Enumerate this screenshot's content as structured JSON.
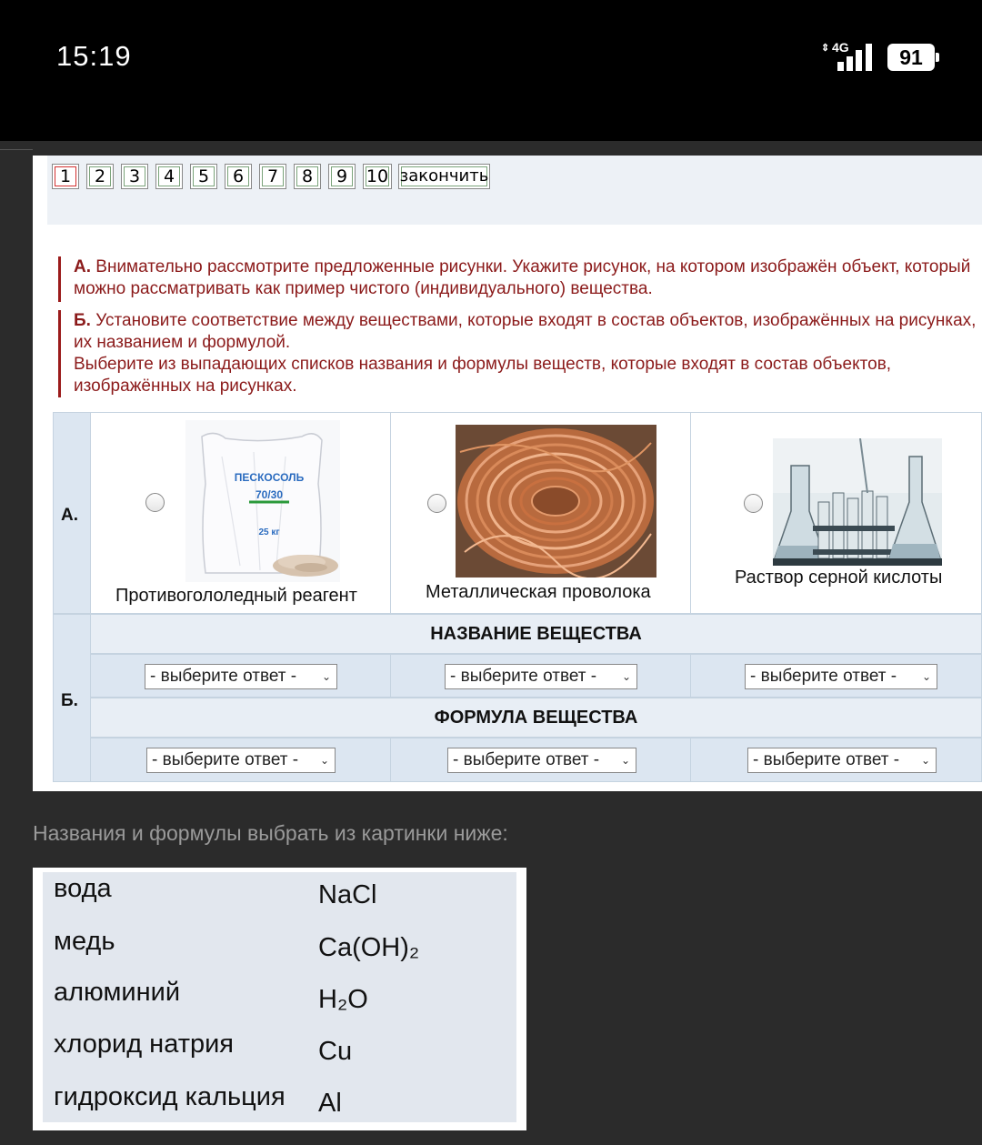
{
  "status_bar": {
    "time": "15:19",
    "network": "4G",
    "battery": "91"
  },
  "nav": {
    "pages": [
      "1",
      "2",
      "3",
      "4",
      "5",
      "6",
      "7",
      "8",
      "9",
      "10"
    ],
    "active_page": "1",
    "finish_label": "закончить"
  },
  "task": {
    "a_prefix": "А.",
    "a_text": "Внимательно рассмотрите предложенные рисунки. Укажите рисунок, на котором изображён объект, который можно рассматривать как пример чистого (индивидуального) вещества.",
    "b_prefix": "Б.",
    "b_text": "Установите соответствие между веществами, которые входят в состав объектов, изображённых на рисунках, и их названием и формулой.",
    "b_text2": "Выберите из выпадающих списков названия и формулы веществ, которые входят в состав объектов, изображённых на рисунках."
  },
  "quiz": {
    "row_a_label": "А.",
    "row_b_label": "Б.",
    "items": [
      {
        "caption": "Противогололедный реагент",
        "bag_label1": "ПЕСКОСОЛЬ",
        "bag_label2": "70/30",
        "bag_label3": "25 кг"
      },
      {
        "caption": "Металлическая проволока"
      },
      {
        "caption": "Раствор серной кислоты"
      }
    ],
    "name_header": "НАЗВАНИЕ ВЕЩЕСТВА",
    "formula_header": "ФОРМУЛА ВЕЩЕСТВА",
    "select_placeholder": "- выберите ответ -"
  },
  "note": "Названия и формулы выбрать из картинки ниже:",
  "word_bank": {
    "names": [
      "вода",
      "медь",
      "алюминий",
      "хлорид натрия",
      "гидроксид кальция"
    ],
    "formulas": [
      "NaCl",
      "Ca(OH)₂",
      "H₂O",
      "Cu",
      "Al"
    ]
  }
}
